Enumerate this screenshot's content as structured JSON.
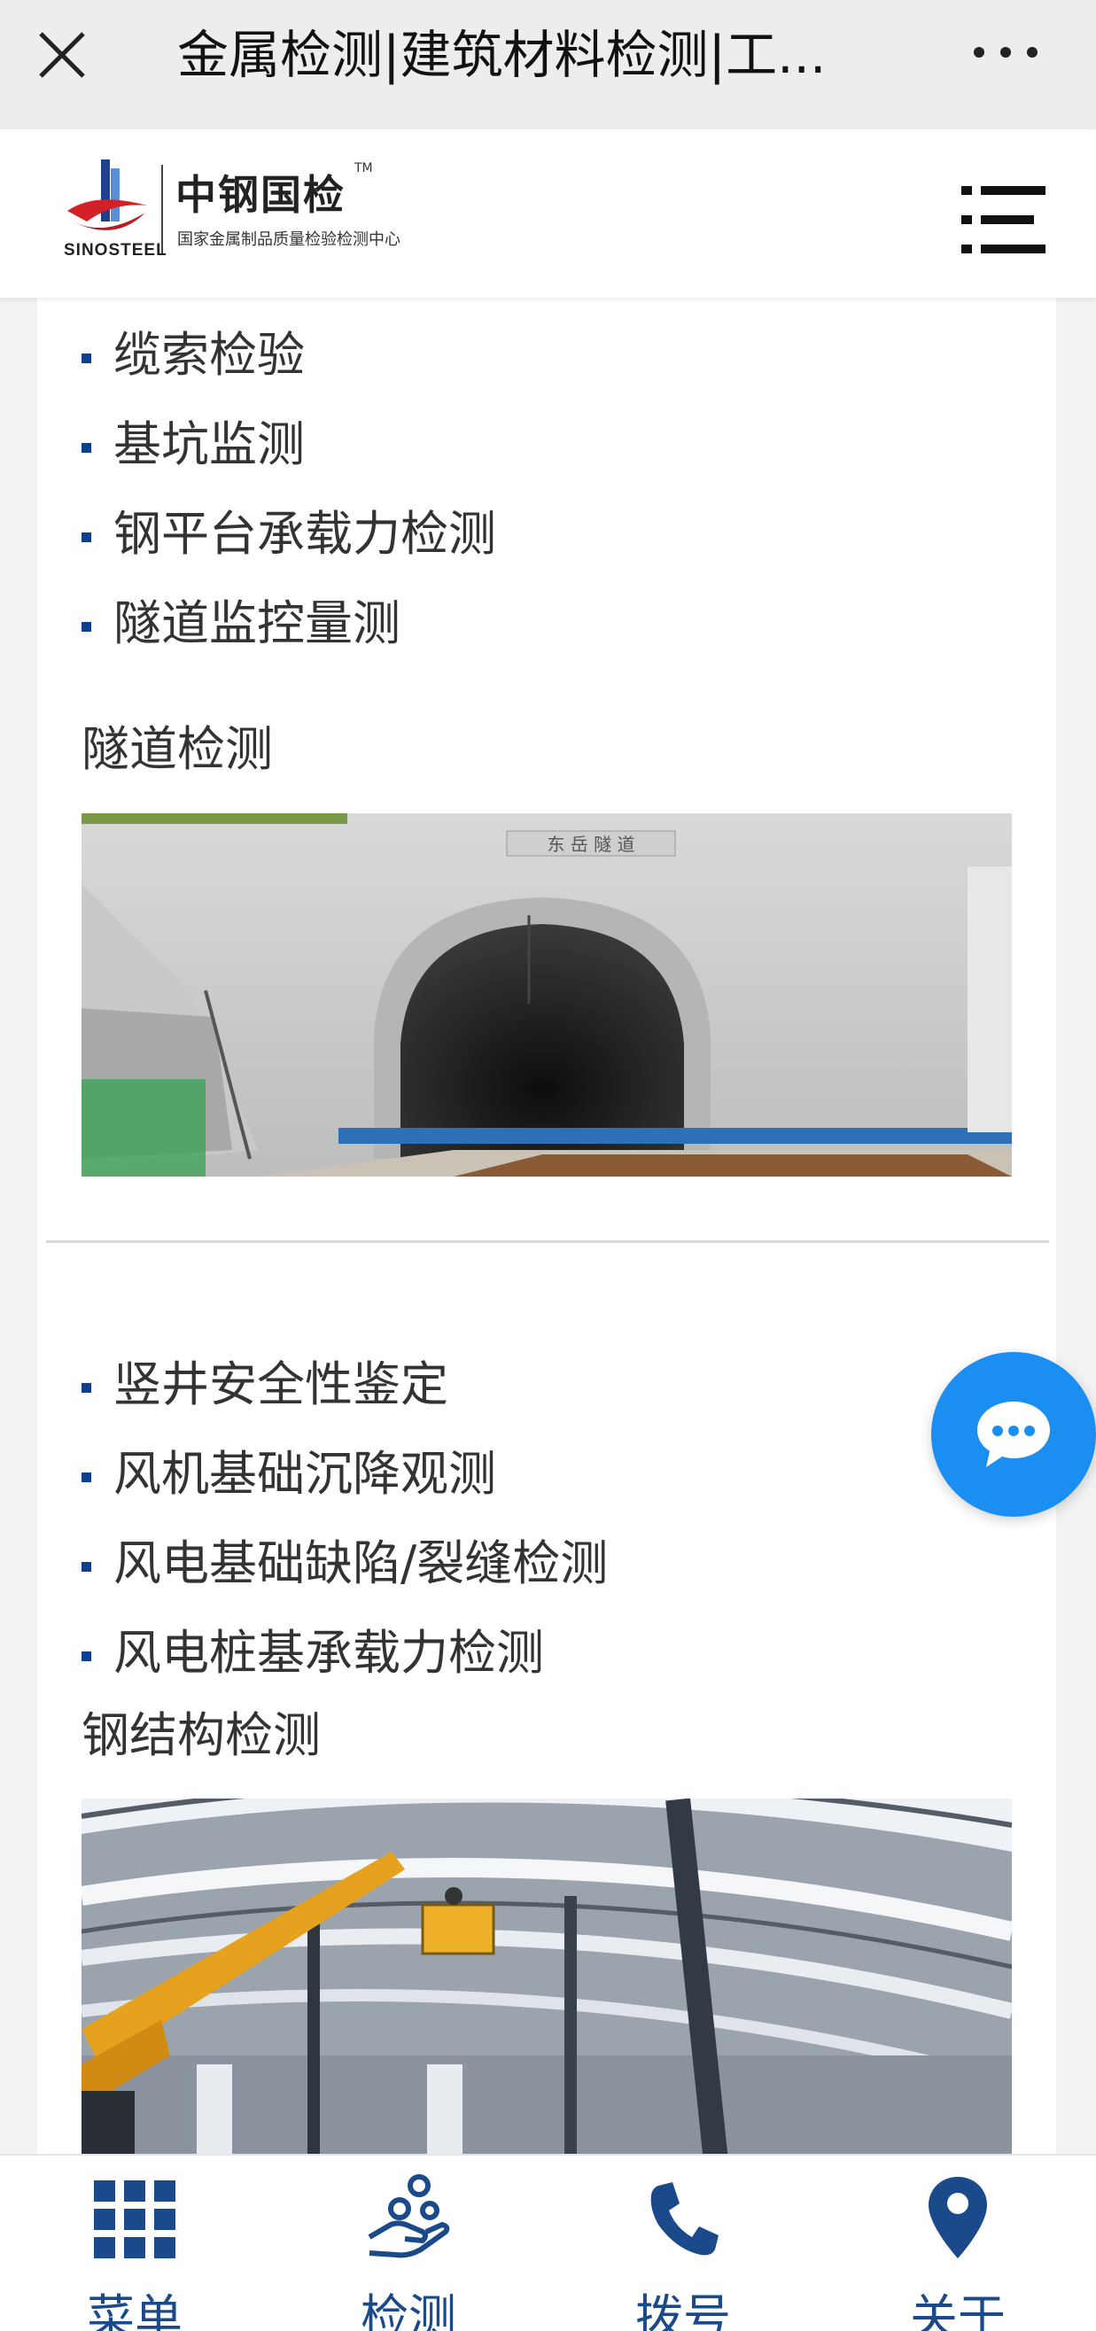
{
  "topbar": {
    "title": "金属检测|建筑材料检测|工..."
  },
  "header": {
    "logo_brand": "中钢国检",
    "logo_tm": "TM",
    "logo_subtitle": "国家金属制品质量检验检测中心",
    "logo_en": "SINOSTEEL"
  },
  "sections": [
    {
      "items": [
        "缆索检验",
        "基坑监测",
        "钢平台承载力检测",
        "隧道监控量测"
      ],
      "title": "隧道检测",
      "tunnel_sign": "东 岳 隧 道"
    },
    {
      "items": [
        "竖井安全性鉴定",
        "风机基础沉降观测",
        "风电基础缺陷/裂缝检测",
        "风电桩基承载力检测"
      ],
      "title": "钢结构检测"
    }
  ],
  "bottom_nav": [
    {
      "label": "菜单",
      "icon": "grid-icon"
    },
    {
      "label": "检测",
      "icon": "hand-coins-icon"
    },
    {
      "label": "拨号",
      "icon": "phone-icon"
    },
    {
      "label": "关于",
      "icon": "map-pin-icon"
    }
  ],
  "colors": {
    "accent": "#1a8ef1",
    "bullet": "#0d3f8f",
    "nav_label": "#1a4a8a"
  }
}
